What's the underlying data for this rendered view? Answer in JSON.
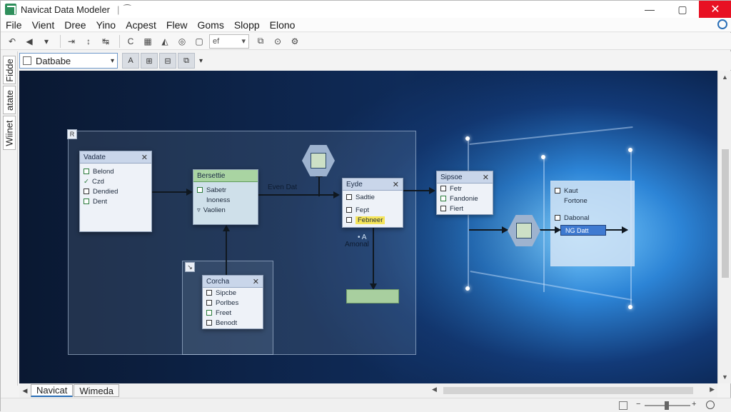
{
  "window": {
    "title": "Navicat Data Modeler",
    "quick_access": "⁀",
    "controls": {
      "minimize": "—",
      "maximize": "▢",
      "close": "✕"
    }
  },
  "menu": [
    "File",
    "Vient",
    "Dree",
    "Yino",
    "Acpest",
    "Flew",
    "Goms",
    "Slopp",
    "Elono"
  ],
  "toolbar1": {
    "undo_label": "↶",
    "icons": [
      "◀",
      "▾",
      "⇥",
      "↕",
      "↹"
    ],
    "refresh": "C",
    "zoom_select_value": "ef",
    "extra": [
      "⧉",
      "⊙",
      "⚙"
    ]
  },
  "toolbar2": {
    "database_select": "Datbabe",
    "buttons": [
      "A",
      "⊞",
      "⊟",
      "⧉"
    ]
  },
  "vtabs": [
    "Fidde",
    "atate",
    "Wiinet"
  ],
  "canvas": {
    "panel_corner_1": "R",
    "panel_corner_2": "↘",
    "entity_vendor": {
      "title": "Vadate",
      "rows": [
        "Belond",
        "Czd",
        "Dendied",
        "Dent"
      ]
    },
    "entity_green": {
      "title": "Bersettie",
      "rows": [
        "Sabetr",
        "Inoness",
        "Vaolien"
      ]
    },
    "entity_mid": {
      "title": "Eyde",
      "rows": [
        "Sadtie",
        "Fept",
        "Febneer"
      ]
    },
    "entity_right": {
      "title": "Sipsoe",
      "rows": [
        "Fetr",
        "Fandonie",
        "Fiert"
      ]
    },
    "entity_bottom": {
      "title": "Corcha",
      "rows": [
        "Sipcbe",
        "Porlbes",
        "Freet",
        "Benodt"
      ]
    },
    "label_evendat": "Even Dat",
    "label_anomal": "Amonal",
    "label_anomal_small": "• A",
    "glass_pane": {
      "rows": [
        "Kaut",
        "Fortone",
        "Dabonal"
      ],
      "bar_text": "NG Datt"
    }
  },
  "bottom_tabs": [
    "Navicat",
    "Wimeda"
  ],
  "colors": {
    "accent": "#2a6fb7",
    "close": "#e81123",
    "entity_green": "#a9d4a2",
    "highlight": "#f4e45a"
  }
}
